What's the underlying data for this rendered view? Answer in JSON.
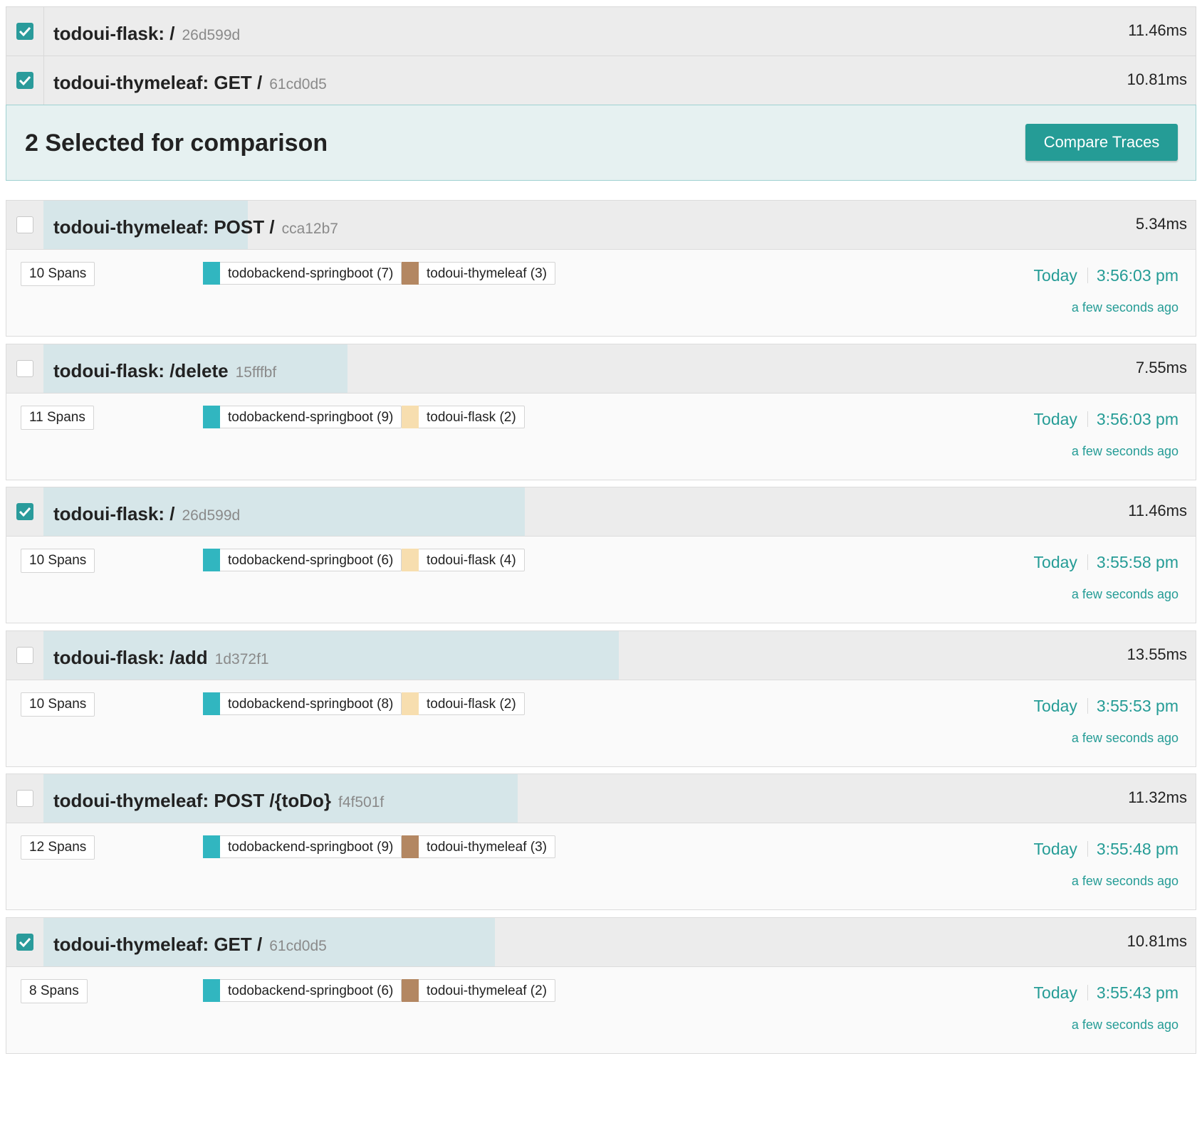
{
  "selected": [
    {
      "service": "todoui-flask",
      "operation": "/",
      "trace_id": "26d599d",
      "duration": "11.46ms",
      "checked": true
    },
    {
      "service": "todoui-thymeleaf",
      "operation": "GET /",
      "trace_id": "61cd0d5",
      "duration": "10.81ms",
      "checked": true
    }
  ],
  "comparison": {
    "text": "2 Selected for comparison",
    "button_label": "Compare Traces"
  },
  "colors": {
    "accent": "#259c96",
    "todobackend-springboot": "#31b6c0",
    "todoui-thymeleaf": "#b38762",
    "todoui-flask": "#f7deaf"
  },
  "traces": [
    {
      "title": "todoui-thymeleaf: POST /",
      "trace_id": "cca12b7",
      "duration": "5.34ms",
      "duration_fraction": 0.394,
      "checked": false,
      "spans": "10 Spans",
      "services": [
        {
          "label": "todobackend-springboot (7)",
          "color": "#31b6c0"
        },
        {
          "label": "todoui-thymeleaf (3)",
          "color": "#b38762"
        }
      ],
      "day": "Today",
      "time": "3:56:03 pm",
      "relative": "a few seconds ago"
    },
    {
      "title": "todoui-flask: /delete",
      "trace_id": "15fffbf",
      "duration": "7.55ms",
      "duration_fraction": 0.557,
      "checked": false,
      "spans": "11 Spans",
      "services": [
        {
          "label": "todobackend-springboot (9)",
          "color": "#31b6c0"
        },
        {
          "label": "todoui-flask (2)",
          "color": "#f7deaf"
        }
      ],
      "day": "Today",
      "time": "3:56:03 pm",
      "relative": "a few seconds ago"
    },
    {
      "title": "todoui-flask: /",
      "trace_id": "26d599d",
      "duration": "11.46ms",
      "duration_fraction": 0.846,
      "checked": true,
      "spans": "10 Spans",
      "services": [
        {
          "label": "todobackend-springboot (6)",
          "color": "#31b6c0"
        },
        {
          "label": "todoui-flask (4)",
          "color": "#f7deaf"
        }
      ],
      "day": "Today",
      "time": "3:55:58 pm",
      "relative": "a few seconds ago"
    },
    {
      "title": "todoui-flask: /add",
      "trace_id": "1d372f1",
      "duration": "13.55ms",
      "duration_fraction": 1.0,
      "checked": false,
      "spans": "10 Spans",
      "services": [
        {
          "label": "todobackend-springboot (8)",
          "color": "#31b6c0"
        },
        {
          "label": "todoui-flask (2)",
          "color": "#f7deaf"
        }
      ],
      "day": "Today",
      "time": "3:55:53 pm",
      "relative": "a few seconds ago"
    },
    {
      "title": "todoui-thymeleaf: POST /{toDo}",
      "trace_id": "f4f501f",
      "duration": "11.32ms",
      "duration_fraction": 0.835,
      "checked": false,
      "spans": "12 Spans",
      "services": [
        {
          "label": "todobackend-springboot (9)",
          "color": "#31b6c0"
        },
        {
          "label": "todoui-thymeleaf (3)",
          "color": "#b38762"
        }
      ],
      "day": "Today",
      "time": "3:55:48 pm",
      "relative": "a few seconds ago"
    },
    {
      "title": "todoui-thymeleaf: GET /",
      "trace_id": "61cd0d5",
      "duration": "10.81ms",
      "duration_fraction": 0.798,
      "checked": true,
      "spans": "8 Spans",
      "services": [
        {
          "label": "todobackend-springboot (6)",
          "color": "#31b6c0"
        },
        {
          "label": "todoui-thymeleaf (2)",
          "color": "#b38762"
        }
      ],
      "day": "Today",
      "time": "3:55:43 pm",
      "relative": "a few seconds ago"
    }
  ]
}
